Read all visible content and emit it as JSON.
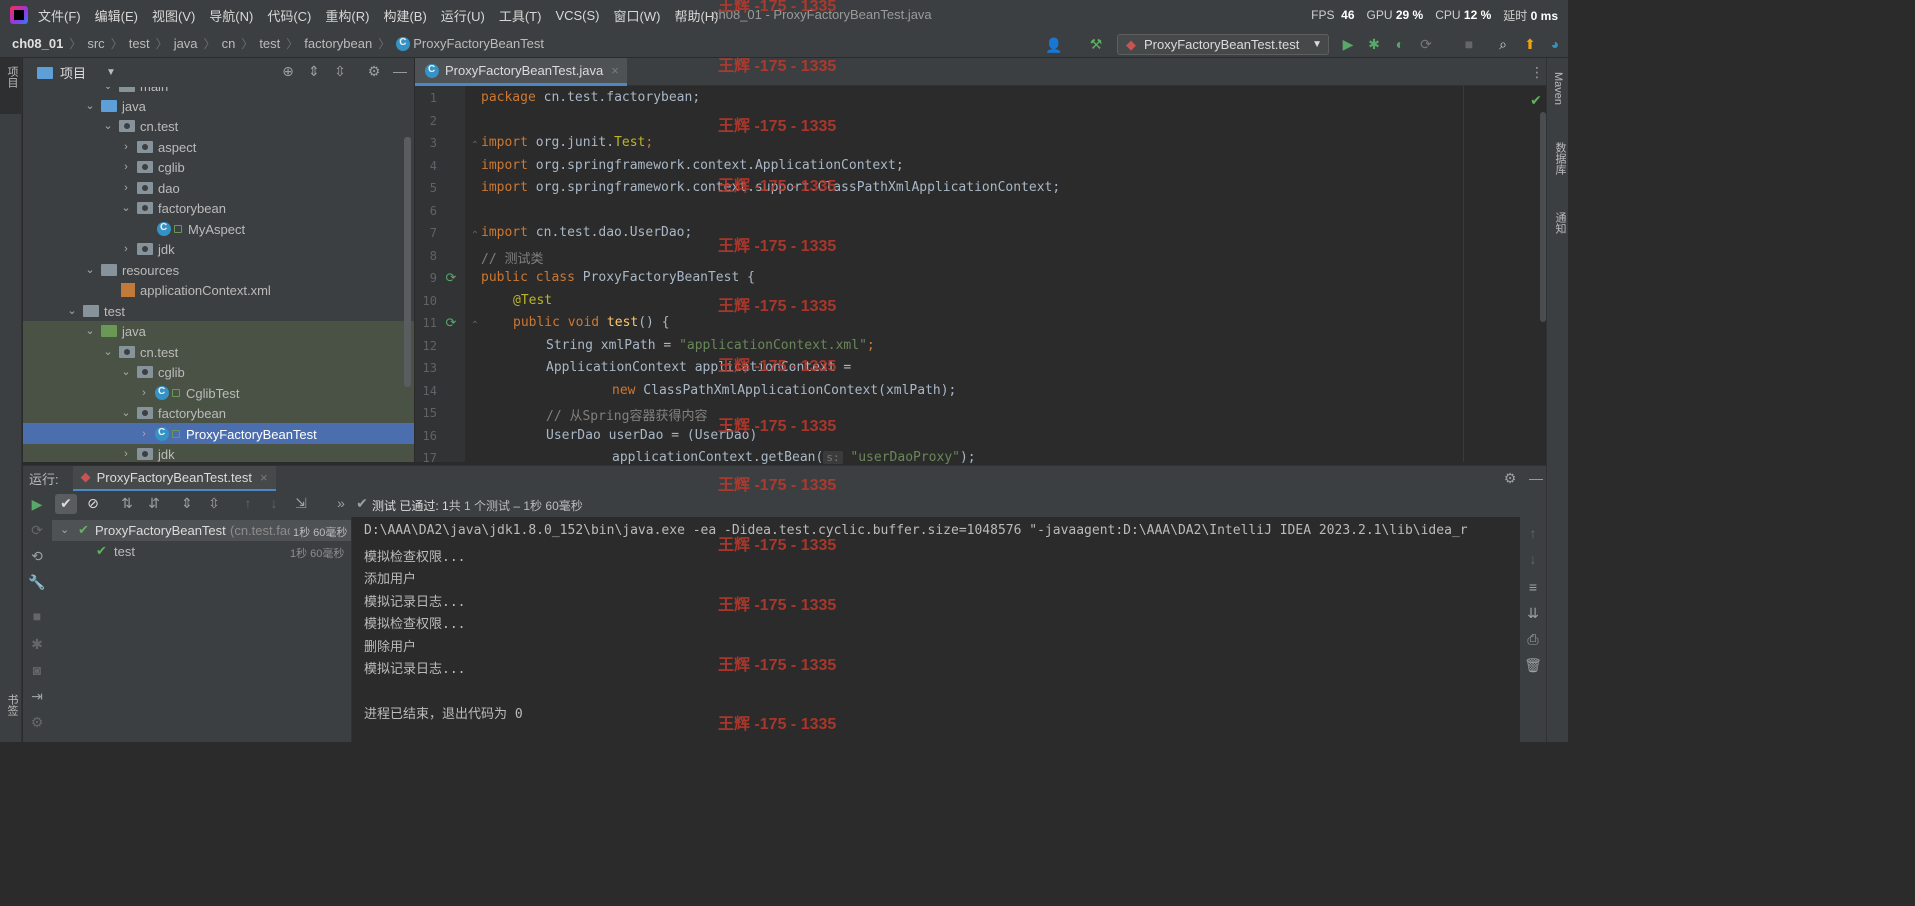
{
  "menu": {
    "items": [
      "文件(F)",
      "编辑(E)",
      "视图(V)",
      "导航(N)",
      "代码(C)",
      "重构(R)",
      "构建(B)",
      "运行(U)",
      "工具(T)",
      "VCS(S)",
      "窗口(W)",
      "帮助(H)"
    ],
    "window_title": "ch08_01 - ProxyFactoryBeanTest.java"
  },
  "perf": {
    "fps_label": "FPS",
    "fps_value": "46",
    "gpu_label": "GPU",
    "gpu_value": "29 %",
    "cpu_label": "CPU",
    "cpu_value": "12 %",
    "latency_label": "延时",
    "latency_value": "0 ms"
  },
  "breadcrumb": [
    "ch08_01",
    "src",
    "test",
    "java",
    "cn",
    "test",
    "factorybean",
    "ProxyFactoryBeanTest"
  ],
  "toolbar": {
    "run_config": "ProxyFactoryBeanTest.test"
  },
  "left_stripe": {
    "project": "项目",
    "bookmarks": "书签"
  },
  "right_stripe": {
    "maven": "Maven",
    "database": "数据库",
    "notifications": "通知"
  },
  "project_panel": {
    "title": "项目",
    "tree": [
      {
        "label": "main",
        "indent": 4
      },
      {
        "label": "java",
        "indent": 5
      },
      {
        "label": "cn.test",
        "indent": 6
      },
      {
        "label": "aspect",
        "indent": 7
      },
      {
        "label": "cglib",
        "indent": 7
      },
      {
        "label": "dao",
        "indent": 7
      },
      {
        "label": "factorybean",
        "indent": 7
      },
      {
        "label": "MyAspect",
        "indent": 8
      },
      {
        "label": "jdk",
        "indent": 7
      },
      {
        "label": "resources",
        "indent": 5
      },
      {
        "label": "applicationContext.xml",
        "indent": 6
      },
      {
        "label": "test",
        "indent": 4
      },
      {
        "label": "java",
        "indent": 5
      },
      {
        "label": "cn.test",
        "indent": 6
      },
      {
        "label": "cglib",
        "indent": 7
      },
      {
        "label": "CglibTest",
        "indent": 8
      },
      {
        "label": "factorybean",
        "indent": 7
      },
      {
        "label": "ProxyFactoryBeanTest",
        "indent": 8
      },
      {
        "label": "jdk",
        "indent": 7
      }
    ]
  },
  "editor": {
    "tab_label": "ProxyFactoryBeanTest.java",
    "line_numbers": [
      "1",
      "2",
      "3",
      "4",
      "5",
      "6",
      "7",
      "8",
      "9",
      "10",
      "11",
      "12",
      "13",
      "14",
      "15",
      "16",
      "17"
    ],
    "lines": {
      "l1_kw": "package",
      "l1_rest": " cn.test.factorybean;",
      "l3_kw": "import",
      "l3_a": " org.junit.",
      "l3_b": "Test",
      "l3_c": ";",
      "l4_kw": "import",
      "l4_rest": " org.springframework.context.ApplicationContext;",
      "l5_kw": "import",
      "l5_rest": " org.springframework.context.support.ClassPathXmlApplicationContext;",
      "l7_kw": "import",
      "l7_rest": " cn.test.dao.UserDao;",
      "l8": "// 测试类",
      "l9_kw": "public class",
      "l9_rest": " ProxyFactoryBeanTest {",
      "l10": "@Test",
      "l11_kw": "public void",
      "l11_fn": " test",
      "l11_rest": "() {",
      "l12_a": "String xmlPath = ",
      "l12_str": "\"applicationContext.xml\"",
      "l12_b": ";",
      "l13": "ApplicationContext applicationContext =",
      "l14_kw": "new",
      "l14_rest": " ClassPathXmlApplicationContext(xmlPath);",
      "l15": "// 从Spring容器获得内容",
      "l16": "UserDao userDao = (UserDao)",
      "l17_a": "applicationContext.getBean(",
      "l17_hint": "s:",
      "l17_str": " \"userDaoProxy\"",
      "l17_b": ");"
    }
  },
  "run_panel": {
    "label": "运行:",
    "tab": "ProxyFactoryBeanTest.test",
    "status_prefix": "测试 已通过:",
    "status_count": "1",
    "status_suffix": "共 1 个测试 – 1秒 60毫秒",
    "tree": {
      "root_name": "ProxyFactoryBeanTest",
      "root_pkg": "(cn.test.fac",
      "root_time": "1秒 60毫秒",
      "child_name": "test",
      "child_time": "1秒 60毫秒"
    },
    "console": [
      "D:\\AAA\\DA2\\java\\jdk1.8.0_152\\bin\\java.exe -ea -Didea.test.cyclic.buffer.size=1048576 \"-javaagent:D:\\AAA\\DA2\\IntelliJ IDEA 2023.2.1\\lib\\idea_r",
      "模拟检查权限...",
      "添加用户",
      "模拟记录日志...",
      "模拟检查权限...",
      "删除用户",
      "模拟记录日志...",
      "",
      "进程已结束，退出代码为 0"
    ]
  },
  "watermark": "王辉 -175 - 1335",
  "colors": {
    "accent": "#4a88c7",
    "selection": "#4b6eaf",
    "test_pass": "#5fb25f",
    "watermark": "#c0392b"
  }
}
